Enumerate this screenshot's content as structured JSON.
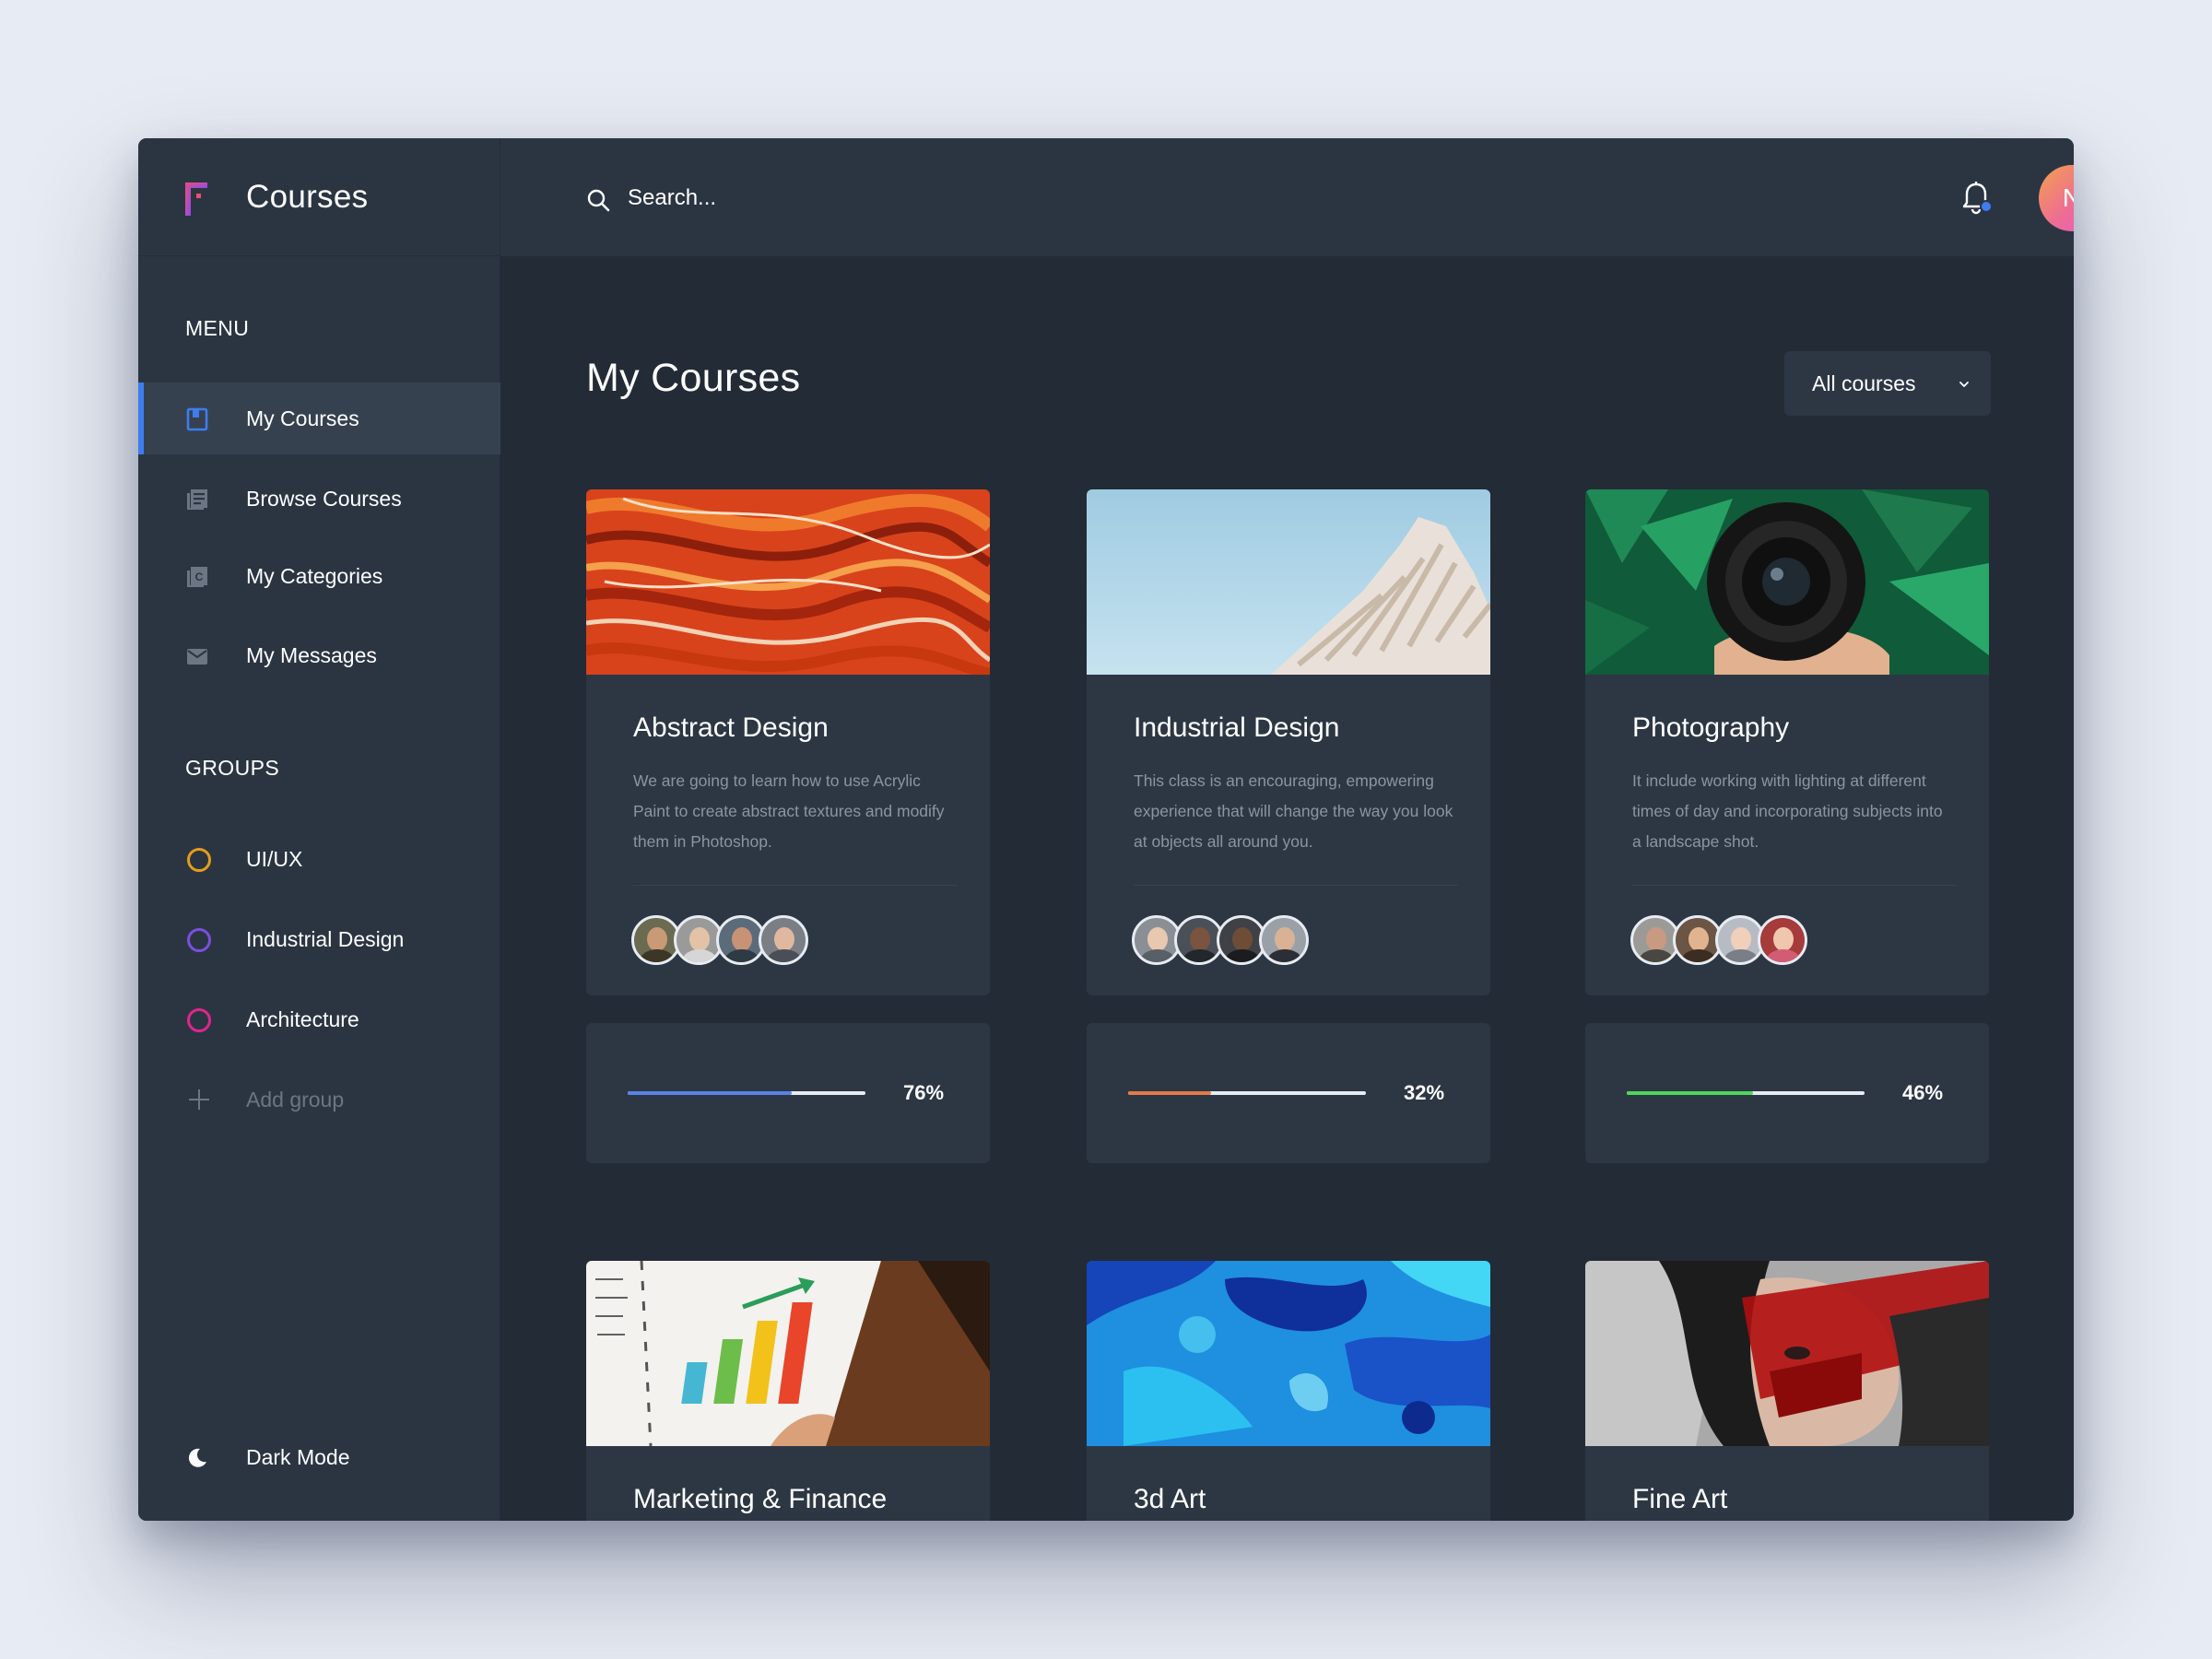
{
  "brand": {
    "title": "Courses"
  },
  "sidebar": {
    "menu_label": "MENU",
    "menu": [
      {
        "label": "My Courses",
        "icon": "book-icon"
      },
      {
        "label": "Browse Courses",
        "icon": "list-icon"
      },
      {
        "label": "My Categories",
        "icon": "categories-icon"
      },
      {
        "label": "My Messages",
        "icon": "mail-icon"
      }
    ],
    "groups_label": "GROUPS",
    "groups": [
      {
        "label": "UI/UX",
        "color": "#e39d1c"
      },
      {
        "label": "Industrial Design",
        "color": "#7b4fe0"
      },
      {
        "label": "Architecture",
        "color": "#e0258f"
      }
    ],
    "add_group_label": "Add group",
    "dark_mode_label": "Dark Mode"
  },
  "topbar": {
    "search_placeholder": "Search...",
    "user_initial": "N"
  },
  "main": {
    "title": "My Courses",
    "filter_label": "All courses",
    "courses": [
      {
        "title": "Abstract Design",
        "description": "We are going to learn how to use Acrylic Paint to create abstract textures and modify them in Photoshop.",
        "progress": 76,
        "progress_label": "76%",
        "progress_color": "#5b82e6"
      },
      {
        "title": "Industrial Design",
        "description": "This class is an encouraging, empowering experience that will change the way you look at objects all around you.",
        "progress": 32,
        "progress_label": "32%",
        "progress_color": "#e47a4b"
      },
      {
        "title": "Photography",
        "description": "It include working with lighting at different times of day  and incorporating subjects into a landscape shot.",
        "progress": 46,
        "progress_label": "46%",
        "progress_color": "#4fd65a"
      },
      {
        "title": "Marketing & Finance"
      },
      {
        "title": "3d Art"
      },
      {
        "title": "Fine Art"
      }
    ]
  }
}
